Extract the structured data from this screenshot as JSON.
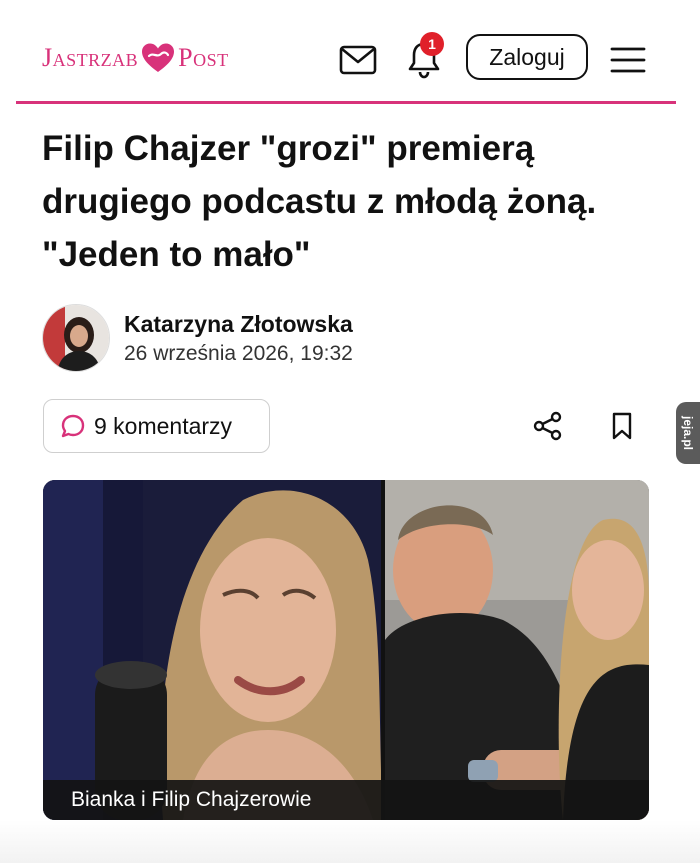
{
  "header": {
    "logo_left": "Jastrzab",
    "logo_right": "Post",
    "notification_count": "1",
    "login_label": "Zaloguj"
  },
  "article": {
    "title": "Filip Chajzer \"grozi\" premierą drugiego podcastu z młodą żoną. \"Jeden to mało\"",
    "author_name": "Katarzyna Złotowska",
    "date": "26 września 2026, 19:32",
    "comments_label": "9 komentarzy",
    "image_caption": "Bianka i Filip Chajzerowie"
  },
  "watermark": "jeja.pl",
  "colors": {
    "brand": "#d8327a",
    "badge": "#e0202a"
  }
}
